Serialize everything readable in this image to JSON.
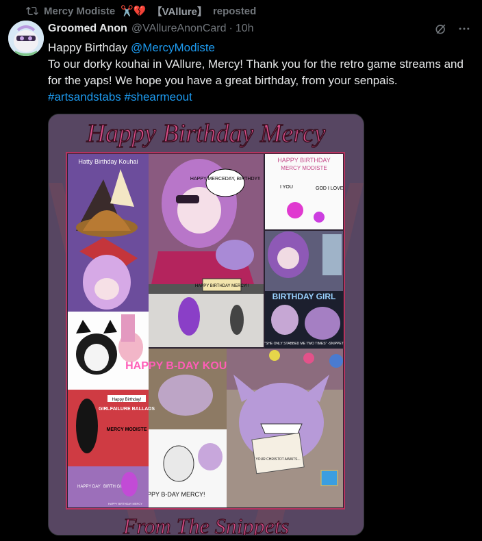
{
  "repost": {
    "icon": "repost-icon",
    "user": "Mercy Modiste",
    "emoji": "✂️💔",
    "tag": "【VAllure】",
    "label": "reposted"
  },
  "author": {
    "display_name": "Groomed Anon",
    "handle": "@VAllureAnonCard",
    "separator": "·",
    "time": "10h"
  },
  "tweet": {
    "line1_prefix": "Happy Birthday ",
    "mention": "@MercyModiste",
    "body": "To our dorky kouhai in VAllure, Mercy! Thank you for the retro game streams and for the yaps! We hope you have a great birthday, from your senpais.",
    "hashtag1": "#artsandstabs",
    "hashtag2": "#shearmeout"
  },
  "media": {
    "banner_top": "Happy Birthday Mercy",
    "banner_bottom": "From The Snippets",
    "panel_hatty": "Hatty Birthday Kouhai",
    "bubble": "HAPPY MERCEDAY, BIRTHDY!!",
    "hb_title": "HAPPY BIRTHDAY",
    "hb_sub": "MERCY MODISTE",
    "i_you": "I YOU",
    "god_love": "GOD I LOVE",
    "birthday_girl": "BIRTHDAY GIRL",
    "caption_quote": "\"SHE ONLY STABBED ME TWO TIMES\" -SNIPPET",
    "happy_birthday_mercy_sign": "HAPPY BIRTHDAY MERCY!!",
    "happy_bday": "HAPPY B-DAY KOUHAI",
    "poster_hb": "Happy Birthday!",
    "poster_gf": "GIRLFAILURE BALLADS",
    "poster_mm": "MERCY MODISTE",
    "card_text": "YOUR CHRISTOT AWAITS...",
    "bday_mercy": "HAPPY B-DAY MERCY!",
    "happy_day": "HAPPY DAY",
    "birth_girl": "BIRTH GIRL",
    "footer_small": "HAPPY BIRTHDAY MERCY"
  }
}
